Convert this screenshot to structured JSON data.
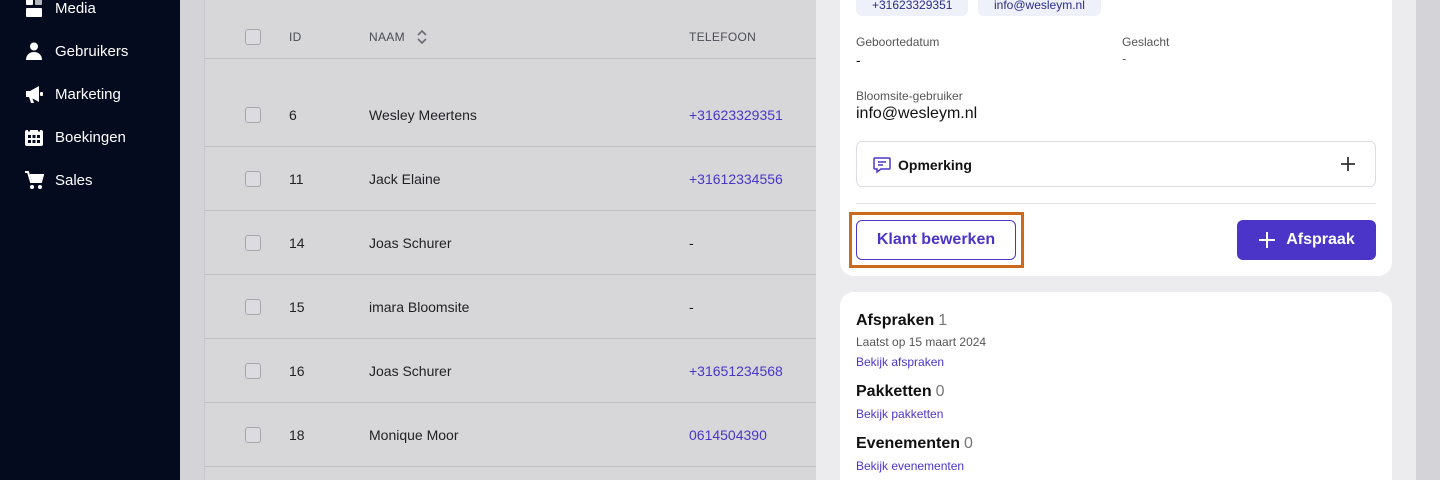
{
  "sidebar": {
    "items": [
      {
        "label": "Media",
        "icon": "media-icon"
      },
      {
        "label": "Gebruikers",
        "icon": "user-icon"
      },
      {
        "label": "Marketing",
        "icon": "megaphone-icon"
      },
      {
        "label": "Boekingen",
        "icon": "calendar-icon"
      },
      {
        "label": "Sales",
        "icon": "cart-icon"
      }
    ]
  },
  "table": {
    "headers": {
      "id": "ID",
      "name": "NAAM",
      "phone": "TELEFOON"
    },
    "rows": [
      {
        "id": "6",
        "name": "Wesley Meertens",
        "phone": "+31623329351"
      },
      {
        "id": "11",
        "name": "Jack Elaine",
        "phone": "+31612334556"
      },
      {
        "id": "14",
        "name": "Joas Schurer",
        "phone": "-"
      },
      {
        "id": "15",
        "name": "imara Bloomsite",
        "phone": "-"
      },
      {
        "id": "16",
        "name": "Joas Schurer",
        "phone": "+31651234568"
      },
      {
        "id": "18",
        "name": "Monique Moor",
        "phone": "0614504390"
      }
    ]
  },
  "drawer": {
    "chips": {
      "phone": "+31623329351",
      "email": "info@wesleym.nl"
    },
    "birthdate": {
      "label": "Geboortedatum",
      "value": "-"
    },
    "gender": {
      "label": "Geslacht",
      "value": "-"
    },
    "bloomsite_user": {
      "label": "Bloomsite-gebruiker",
      "value": "info@wesleym.nl"
    },
    "note": {
      "label": "Opmerking"
    },
    "edit_button": "Klant bewerken",
    "appointment_button": "Afspraak",
    "sections": {
      "appointments": {
        "title": "Afspraken",
        "count": "1",
        "sub": "Laatst op 15 maart 2024",
        "link": "Bekijk afspraken"
      },
      "packages": {
        "title": "Pakketten",
        "count": "0",
        "link": "Bekijk pakketten"
      },
      "events": {
        "title": "Evenementen",
        "count": "0",
        "link": "Bekijk evenementen"
      }
    }
  },
  "colors": {
    "accent": "#4b35c9",
    "sidebar_bg": "#050b1e",
    "highlight": "#cc6a1a"
  }
}
